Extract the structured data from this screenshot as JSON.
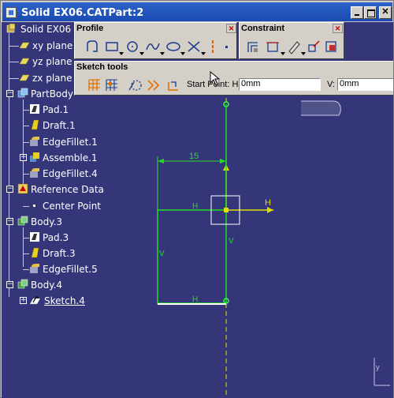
{
  "window": {
    "title": "Solid EX06.CATPart:2"
  },
  "tree": {
    "root": "Solid EX06",
    "items": [
      {
        "label": "xy plane",
        "icon": "plane-icon"
      },
      {
        "label": "yz plane",
        "icon": "plane-icon"
      },
      {
        "label": "zx plane",
        "icon": "plane-icon"
      },
      {
        "label": "PartBody",
        "icon": "partbody-icon"
      },
      {
        "label": "Pad.1",
        "icon": "pad-icon"
      },
      {
        "label": "Draft.1",
        "icon": "draft-icon"
      },
      {
        "label": "EdgeFillet.1",
        "icon": "edgefillet-icon"
      },
      {
        "label": "Assemble.1",
        "icon": "assemble-icon"
      },
      {
        "label": "EdgeFillet.4",
        "icon": "edgefillet-icon"
      },
      {
        "label": "Reference Data",
        "icon": "reference-data-icon"
      },
      {
        "label": "Center Point",
        "icon": "point-icon"
      },
      {
        "label": "Body.3",
        "icon": "body-icon"
      },
      {
        "label": "Pad.3",
        "icon": "pad-icon"
      },
      {
        "label": "Draft.3",
        "icon": "draft-icon"
      },
      {
        "label": "EdgeFillet.5",
        "icon": "edgefillet-icon"
      },
      {
        "label": "Body.4",
        "icon": "body-icon"
      },
      {
        "label": "Sketch.4",
        "icon": "sketch-icon"
      }
    ]
  },
  "toolbars": {
    "profile": {
      "title": "Profile",
      "buttons": [
        "profile-icon",
        "rectangle-icon",
        "circle-icon",
        "spline-icon",
        "ellipse-icon",
        "line-icon",
        "axis-icon",
        "point-icon"
      ]
    },
    "constraint": {
      "title": "Constraint",
      "buttons": [
        "constraint-dialog-icon",
        "constraint-icon",
        "contact-constraint-icon",
        "fix-together-icon",
        "animate-constraint-icon"
      ]
    },
    "sketch_tools": {
      "title": "Sketch tools",
      "buttons": [
        "grid-icon",
        "snap-to-point-icon",
        "construction-element-icon",
        "geometric-constraints-icon",
        "dimensional-constraints-icon"
      ],
      "start_point_label": "Start Point: H:",
      "h_value": "0mm",
      "v_label": "V:",
      "v_value": "0mm"
    }
  },
  "sketch": {
    "dimension_label": "15",
    "h_axis_label": "H",
    "constraint_labels": {
      "horizontal": "H",
      "vertical": "V"
    },
    "colors": {
      "background": "#35367a",
      "geometry": "#22dd22",
      "axis": "#dddd00",
      "selection": "#ffffff"
    }
  }
}
